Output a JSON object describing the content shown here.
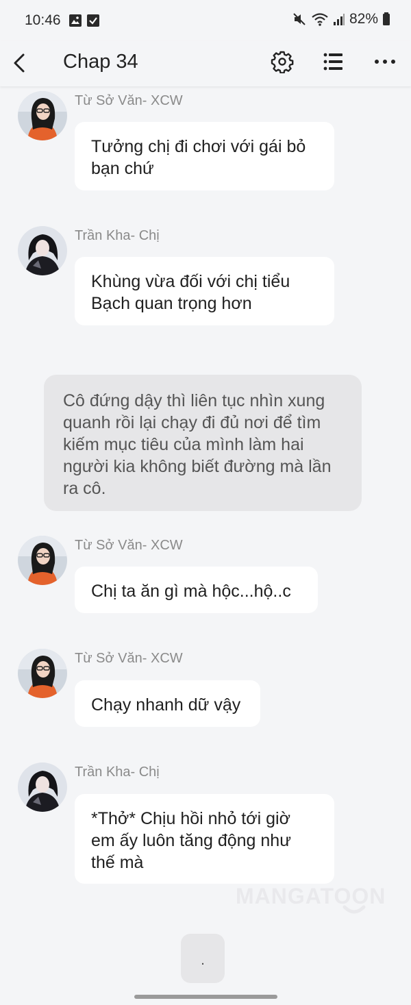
{
  "status": {
    "time": "10:46",
    "battery": "82%"
  },
  "app_bar": {
    "title": "Chap 34"
  },
  "messages": [
    {
      "sender": "Từ Sở Văn- XCW",
      "text": "Tưởng chị đi chơi với gái bỏ bạn chứ",
      "avatar": "avatar-tu-so-van"
    },
    {
      "sender": "Trần Kha- Chị",
      "text": "Khùng vừa đối với chị tiểu Bạch quan trọng hơn",
      "avatar": "avatar-tran-kha"
    },
    {
      "narration": "Cô đứng dậy thì liên tục nhìn xung quanh rồi lại chạy đi đủ nơi để tìm kiếm mục tiêu của mình làm hai người kia không biết đường mà lần ra cô."
    },
    {
      "sender": "Từ Sở Văn- XCW",
      "text": "Chị ta ăn gì mà hộc...hộ..c",
      "avatar": "avatar-tu-so-van"
    },
    {
      "sender": "Từ Sở Văn- XCW",
      "text": "Chạy nhanh dữ vậy",
      "avatar": "avatar-tu-so-van"
    },
    {
      "sender": "Trần Kha- Chị",
      "text": "*Thở* Chịu hồi nhỏ tới giờ em ấy luôn tăng động như thế mà",
      "avatar": "avatar-tran-kha"
    }
  ],
  "watermark": "MANGATOON",
  "next_button": {
    "label": "."
  },
  "icons": [
    "image-icon",
    "check-icon",
    "mute-icon",
    "wifi-icon",
    "signal-icon",
    "battery-icon",
    "back-icon",
    "gear-icon",
    "list-icon",
    "more-icon"
  ]
}
